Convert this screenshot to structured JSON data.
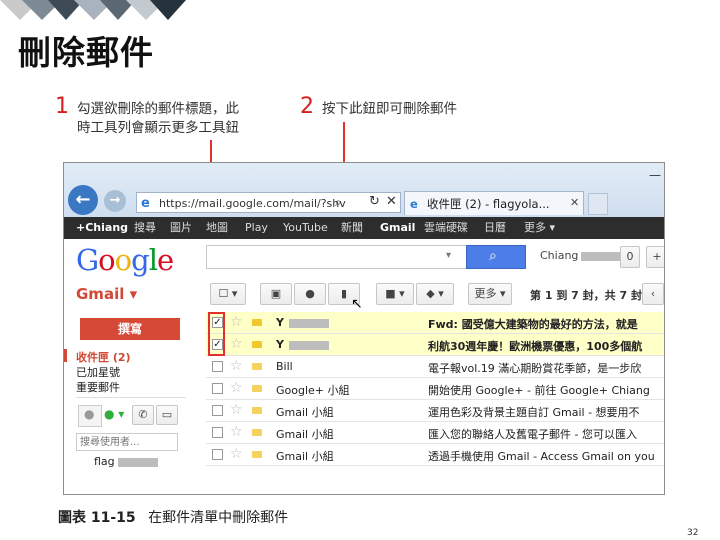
{
  "page_title": "刪除郵件",
  "notes": [
    {
      "num": "1",
      "line1": "勾選欲刪除的郵件標題，此",
      "line2": "時工具列會顯示更多工具鈕"
    },
    {
      "num": "2",
      "line1": "按下此鈕即可刪除郵件",
      "line2": ""
    }
  ],
  "browser": {
    "address": "https://mail.google.com/mail/?shv",
    "tab_label": "收件匣 (2) - flagyola..."
  },
  "google_bar": [
    "+Chiang",
    "搜尋",
    "圖片",
    "地圖",
    "Play",
    "YouTube",
    "新聞",
    "Gmail",
    "雲端硬碟",
    "日曆",
    "更多 ▾"
  ],
  "logo_text": "Google",
  "user": {
    "name": "Chiang",
    "count": "0"
  },
  "gmail_label": "Gmail ▾",
  "toolbar": {
    "more_label": "更多 ▾",
    "pager": "第 1 到 7 封，共 7 封"
  },
  "sidebar": {
    "compose_label": "撰寫",
    "items": [
      "收件匣 (2)",
      "已加星號",
      "重要郵件"
    ],
    "chat_search_placeholder": "搜尋使用者...",
    "account": "flag"
  },
  "emails": [
    {
      "sender": "Y",
      "subject": "Fwd: 國受億大建築物的最好的方法，就是",
      "selected": true
    },
    {
      "sender": "Y",
      "subject": "利航30週年慶！歐洲機票優惠，100多個航",
      "selected": true
    },
    {
      "sender": "Bill",
      "subject": "電子報vol.19 滿心期盼賞花季節，是一步欣",
      "selected": false
    },
    {
      "sender": "Google+ 小組",
      "subject": "開始使用 Google+ - 前往 Google+ Chiang",
      "selected": false
    },
    {
      "sender": "Gmail 小組",
      "subject": "運用色彩及背景主題自訂 Gmail - 想要用不",
      "selected": false
    },
    {
      "sender": "Gmail 小組",
      "subject": "匯入您的聯絡人及舊電子郵件 - 您可以匯入",
      "selected": false
    },
    {
      "sender": "Gmail 小組",
      "subject": "透過手機使用 Gmail - Access Gmail on you",
      "selected": false
    }
  ],
  "caption": {
    "prefix": "圖表 11-15",
    "text": "在郵件清單中刪除郵件"
  },
  "page_number": "32",
  "colors": {
    "accent_red": "#e23030",
    "gmail_red": "#d14836",
    "selected_row": "#ffffc8"
  }
}
